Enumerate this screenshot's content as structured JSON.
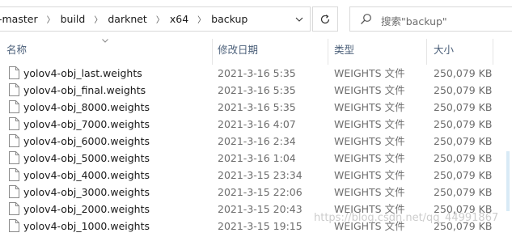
{
  "address_bar": {
    "crumbs": [
      "-master",
      "build",
      "darknet",
      "x64",
      "backup"
    ],
    "separator": "〉"
  },
  "search": {
    "placeholder": "搜索\"backup\""
  },
  "columns": {
    "name": "名称",
    "date": "修改日期",
    "type": "类型",
    "size": "大小"
  },
  "files": [
    {
      "name": "yolov4-obj_last.weights",
      "date": "2021-3-16 5:35",
      "type": "WEIGHTS 文件",
      "size": "250,079 KB"
    },
    {
      "name": "yolov4-obj_final.weights",
      "date": "2021-3-16 5:35",
      "type": "WEIGHTS 文件",
      "size": "250,079 KB"
    },
    {
      "name": "yolov4-obj_8000.weights",
      "date": "2021-3-16 5:35",
      "type": "WEIGHTS 文件",
      "size": "250,079 KB"
    },
    {
      "name": "yolov4-obj_7000.weights",
      "date": "2021-3-16 4:07",
      "type": "WEIGHTS 文件",
      "size": "250,079 KB"
    },
    {
      "name": "yolov4-obj_6000.weights",
      "date": "2021-3-16 2:34",
      "type": "WEIGHTS 文件",
      "size": "250,079 KB"
    },
    {
      "name": "yolov4-obj_5000.weights",
      "date": "2021-3-16 1:04",
      "type": "WEIGHTS 文件",
      "size": "250,079 KB"
    },
    {
      "name": "yolov4-obj_4000.weights",
      "date": "2021-3-15 23:34",
      "type": "WEIGHTS 文件",
      "size": "250,079 KB"
    },
    {
      "name": "yolov4-obj_3000.weights",
      "date": "2021-3-15 22:06",
      "type": "WEIGHTS 文件",
      "size": "250,079 KB"
    },
    {
      "name": "yolov4-obj_2000.weights",
      "date": "2021-3-15 20:43",
      "type": "WEIGHTS 文件",
      "size": "250,079 KB"
    },
    {
      "name": "yolov4-obj_1000.weights",
      "date": "2021-3-15 19:15",
      "type": "WEIGHTS 文件",
      "size": "250,079 KB"
    }
  ],
  "watermark": "https://blog.csdn.net/qq_44991867",
  "colors": {
    "header_text": "#4c607a",
    "border": "#d9d9d9",
    "meta_text": "#6d6d6d"
  },
  "icons": {
    "search": "search-icon",
    "refresh": "refresh-icon",
    "file": "file-icon",
    "dropdown": "chevron-down-icon"
  }
}
